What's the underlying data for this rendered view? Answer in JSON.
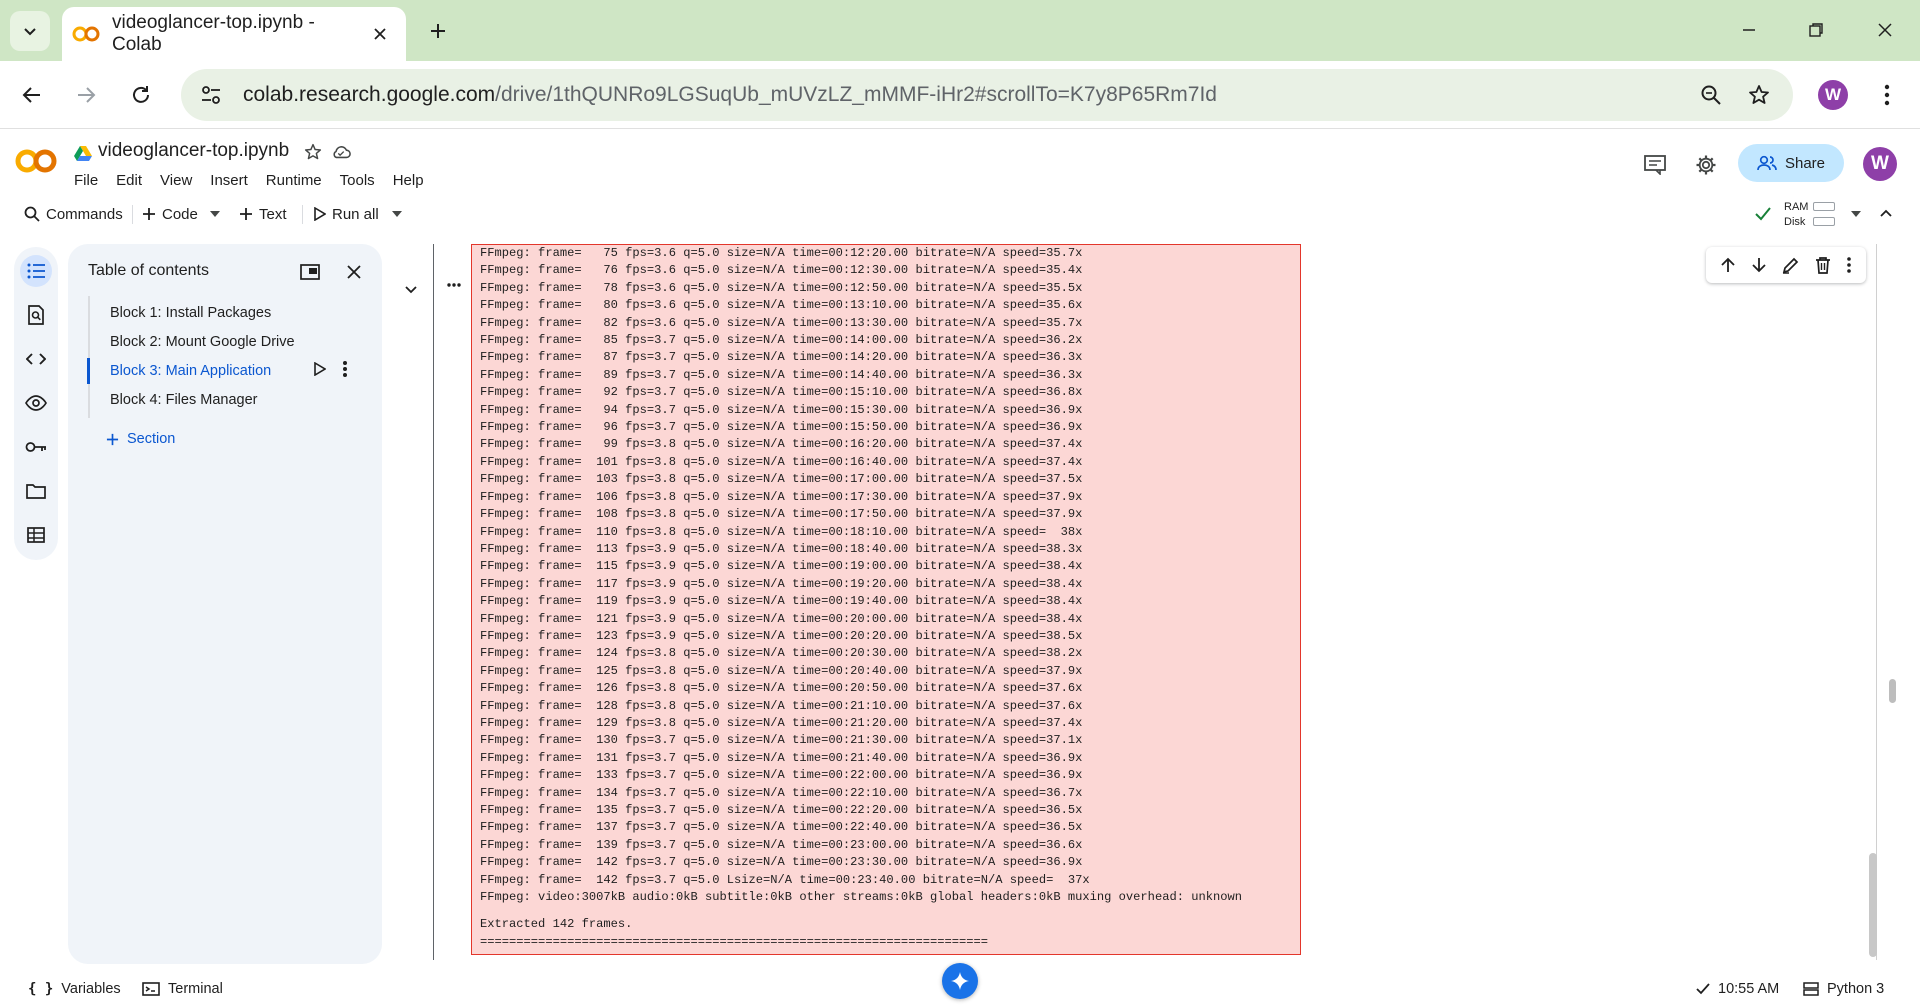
{
  "browser": {
    "tab_title": "videoglancer-top.ipynb - Colab",
    "url_host": "colab.research.google.com",
    "url_path": "/drive/1thQUNRo9LGSuqUb_mUVzLZ_mMMF-iHr2#scrollTo=K7y8P65Rm7Id",
    "profile_initial": "W"
  },
  "colab": {
    "notebook_title": "videoglancer-top.ipynb",
    "menu": [
      "File",
      "Edit",
      "View",
      "Insert",
      "Runtime",
      "Tools",
      "Help"
    ],
    "share_label": "Share",
    "profile_initial": "W",
    "toolbar": {
      "commands": "Commands",
      "code": "Code",
      "text": "Text",
      "run_all": "Run all"
    },
    "ram_label": "RAM",
    "disk_label": "Disk"
  },
  "toc": {
    "title": "Table of contents",
    "items": [
      {
        "label": "Block 1: Install Packages"
      },
      {
        "label": "Block 2: Mount Google Drive"
      },
      {
        "label": "Block 3: Main Application"
      },
      {
        "label": "Block 4: Files Manager"
      }
    ],
    "add_section": "Section"
  },
  "output": {
    "lines": [
      "FFmpeg: frame=   75 fps=3.6 q=5.0 size=N/A time=00:12:20.00 bitrate=N/A speed=35.7x",
      "FFmpeg: frame=   76 fps=3.6 q=5.0 size=N/A time=00:12:30.00 bitrate=N/A speed=35.4x",
      "FFmpeg: frame=   78 fps=3.6 q=5.0 size=N/A time=00:12:50.00 bitrate=N/A speed=35.5x",
      "FFmpeg: frame=   80 fps=3.6 q=5.0 size=N/A time=00:13:10.00 bitrate=N/A speed=35.6x",
      "FFmpeg: frame=   82 fps=3.6 q=5.0 size=N/A time=00:13:30.00 bitrate=N/A speed=35.7x",
      "FFmpeg: frame=   85 fps=3.7 q=5.0 size=N/A time=00:14:00.00 bitrate=N/A speed=36.2x",
      "FFmpeg: frame=   87 fps=3.7 q=5.0 size=N/A time=00:14:20.00 bitrate=N/A speed=36.3x",
      "FFmpeg: frame=   89 fps=3.7 q=5.0 size=N/A time=00:14:40.00 bitrate=N/A speed=36.3x",
      "FFmpeg: frame=   92 fps=3.7 q=5.0 size=N/A time=00:15:10.00 bitrate=N/A speed=36.8x",
      "FFmpeg: frame=   94 fps=3.7 q=5.0 size=N/A time=00:15:30.00 bitrate=N/A speed=36.9x",
      "FFmpeg: frame=   96 fps=3.7 q=5.0 size=N/A time=00:15:50.00 bitrate=N/A speed=36.9x",
      "FFmpeg: frame=   99 fps=3.8 q=5.0 size=N/A time=00:16:20.00 bitrate=N/A speed=37.4x",
      "FFmpeg: frame=  101 fps=3.8 q=5.0 size=N/A time=00:16:40.00 bitrate=N/A speed=37.4x",
      "FFmpeg: frame=  103 fps=3.8 q=5.0 size=N/A time=00:17:00.00 bitrate=N/A speed=37.5x",
      "FFmpeg: frame=  106 fps=3.8 q=5.0 size=N/A time=00:17:30.00 bitrate=N/A speed=37.9x",
      "FFmpeg: frame=  108 fps=3.8 q=5.0 size=N/A time=00:17:50.00 bitrate=N/A speed=37.9x",
      "FFmpeg: frame=  110 fps=3.8 q=5.0 size=N/A time=00:18:10.00 bitrate=N/A speed=  38x",
      "FFmpeg: frame=  113 fps=3.9 q=5.0 size=N/A time=00:18:40.00 bitrate=N/A speed=38.3x",
      "FFmpeg: frame=  115 fps=3.9 q=5.0 size=N/A time=00:19:00.00 bitrate=N/A speed=38.4x",
      "FFmpeg: frame=  117 fps=3.9 q=5.0 size=N/A time=00:19:20.00 bitrate=N/A speed=38.4x",
      "FFmpeg: frame=  119 fps=3.9 q=5.0 size=N/A time=00:19:40.00 bitrate=N/A speed=38.4x",
      "FFmpeg: frame=  121 fps=3.9 q=5.0 size=N/A time=00:20:00.00 bitrate=N/A speed=38.4x",
      "FFmpeg: frame=  123 fps=3.9 q=5.0 size=N/A time=00:20:20.00 bitrate=N/A speed=38.5x",
      "FFmpeg: frame=  124 fps=3.8 q=5.0 size=N/A time=00:20:30.00 bitrate=N/A speed=38.2x",
      "FFmpeg: frame=  125 fps=3.8 q=5.0 size=N/A time=00:20:40.00 bitrate=N/A speed=37.9x",
      "FFmpeg: frame=  126 fps=3.8 q=5.0 size=N/A time=00:20:50.00 bitrate=N/A speed=37.6x",
      "FFmpeg: frame=  128 fps=3.8 q=5.0 size=N/A time=00:21:10.00 bitrate=N/A speed=37.6x",
      "FFmpeg: frame=  129 fps=3.8 q=5.0 size=N/A time=00:21:20.00 bitrate=N/A speed=37.4x",
      "FFmpeg: frame=  130 fps=3.7 q=5.0 size=N/A time=00:21:30.00 bitrate=N/A speed=37.1x",
      "FFmpeg: frame=  131 fps=3.7 q=5.0 size=N/A time=00:21:40.00 bitrate=N/A speed=36.9x",
      "FFmpeg: frame=  133 fps=3.7 q=5.0 size=N/A time=00:22:00.00 bitrate=N/A speed=36.9x",
      "FFmpeg: frame=  134 fps=3.7 q=5.0 size=N/A time=00:22:10.00 bitrate=N/A speed=36.7x",
      "FFmpeg: frame=  135 fps=3.7 q=5.0 size=N/A time=00:22:20.00 bitrate=N/A speed=36.5x",
      "FFmpeg: frame=  137 fps=3.7 q=5.0 size=N/A time=00:22:40.00 bitrate=N/A speed=36.5x",
      "FFmpeg: frame=  139 fps=3.7 q=5.0 size=N/A time=00:23:00.00 bitrate=N/A speed=36.6x",
      "FFmpeg: frame=  142 fps=3.7 q=5.0 size=N/A time=00:23:30.00 bitrate=N/A speed=36.9x",
      "FFmpeg: frame=  142 fps=3.7 q=5.0 Lsize=N/A time=00:23:40.00 bitrate=N/A speed=  37x",
      "FFmpeg: video:3007kB audio:0kB subtitle:0kB other streams:0kB global headers:0kB muxing overhead: unknown",
      "",
      "Extracted 142 frames.",
      "======================================================================"
    ]
  },
  "statusbar": {
    "variables": "Variables",
    "terminal": "Terminal",
    "time": "10:55 AM",
    "runtime": "Python 3"
  },
  "colors": {
    "tab_strip": "#cfe6c5",
    "omnibox": "#e9f1e5",
    "output_bg": "#fcd7d5",
    "output_border": "#e3362b",
    "accent": "#0b57d0",
    "share_bg": "#c2e7ff",
    "avatar": "#8e3fa8"
  }
}
